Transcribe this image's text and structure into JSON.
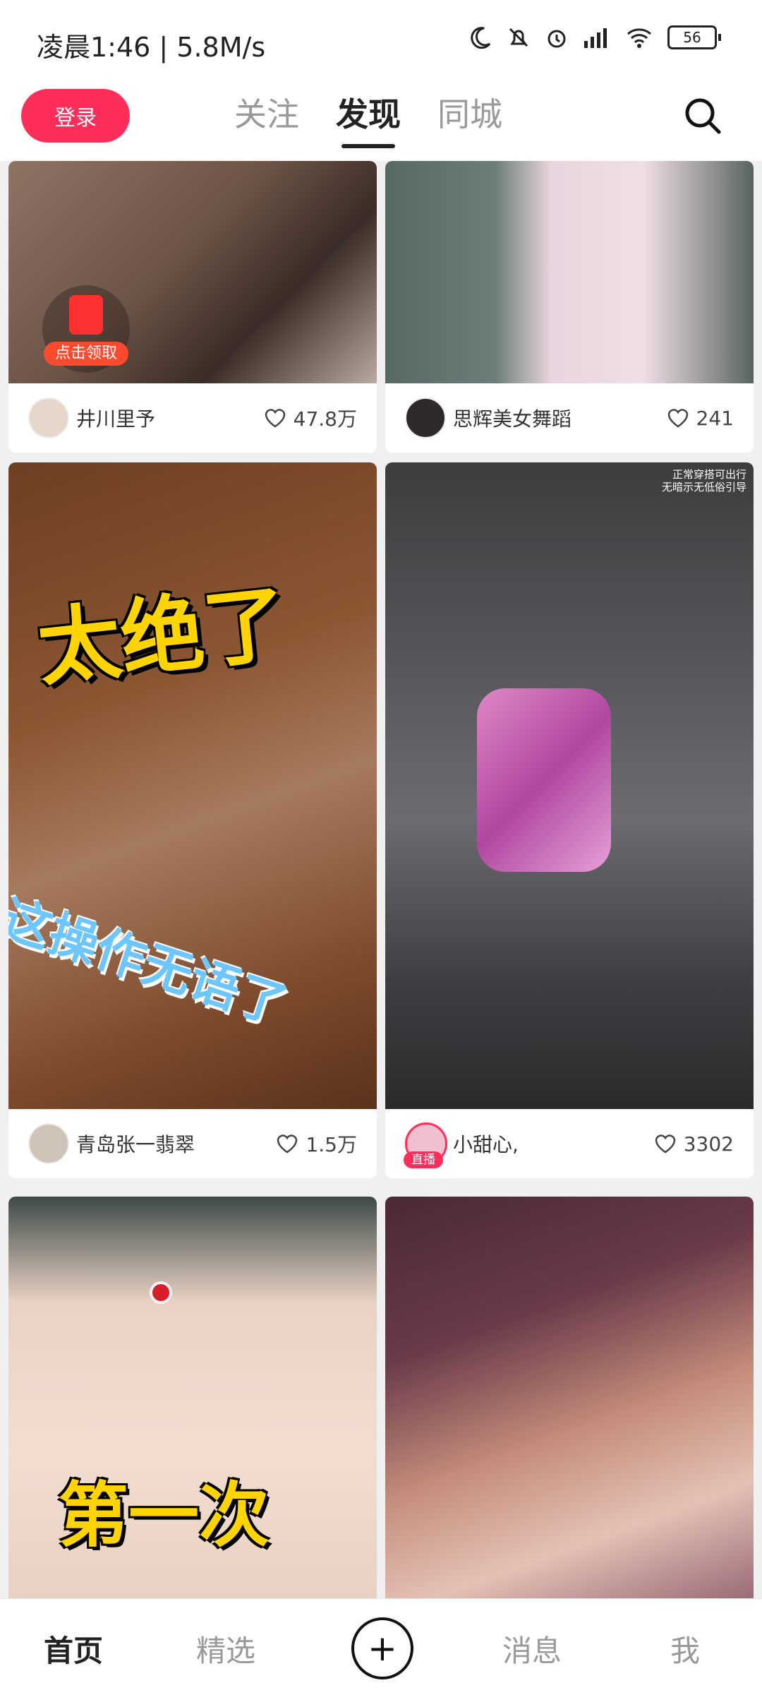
{
  "status": {
    "time": "凌晨1:46 | 5.8M/s",
    "battery": "56"
  },
  "topbar": {
    "login_label": "登录",
    "tabs": [
      {
        "label": "关注"
      },
      {
        "label": "发现"
      },
      {
        "label": "同城"
      }
    ]
  },
  "cards": [
    {
      "author": "井川里予",
      "likes": "47.8万",
      "badge": "点击领取"
    },
    {
      "author": "思辉美女舞蹈",
      "likes": "241"
    },
    {
      "author": "青岛张一翡翠",
      "likes": "1.5万",
      "overlay_top": "太绝了",
      "overlay_bottom": "这操作无语了"
    },
    {
      "author": "小甜心,",
      "likes": "3302",
      "live": "直播",
      "overlay_corner": "正常穿搭可出行\n无暗示无低俗引导"
    },
    {
      "overlay_bottom": "第一次"
    },
    {}
  ],
  "bottom_nav": {
    "home": "首页",
    "featured": "精选",
    "plus": "+",
    "messages": "消息",
    "me": "我"
  },
  "colors": {
    "accent": "#ff2d5a"
  }
}
